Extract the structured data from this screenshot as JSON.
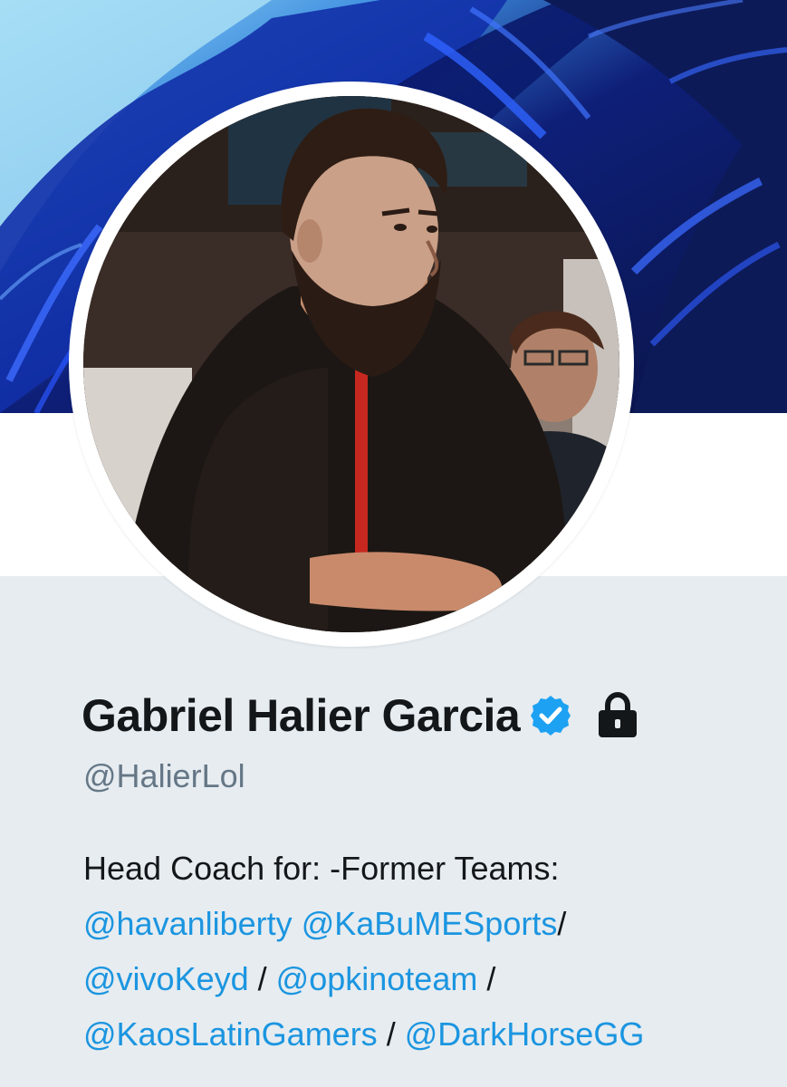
{
  "profile": {
    "display_name": "Gabriel Halier Garcia",
    "verified_icon": "verified-badge-icon",
    "protected_icon": "lock-icon",
    "handle": "@HalierLol",
    "bio": {
      "line1": "Head Coach for: -Former Teams:",
      "mentions": {
        "m1": "@havanliberty",
        "m2": "@KaBuMESports",
        "m3": "@vivoKeyd",
        "m4": "@opkinoteam",
        "m5": "@KaosLatinGamers",
        "m6": "@DarkHorseGG"
      },
      "separators": {
        "s1": "/",
        "s2": "/",
        "s3": "/",
        "s4": "/"
      }
    }
  },
  "colors": {
    "background": "#e6ecf0",
    "name_text": "#14171a",
    "handle_text": "#657786",
    "link": "#1b95e0",
    "verified_badge": "#1da1f2"
  }
}
